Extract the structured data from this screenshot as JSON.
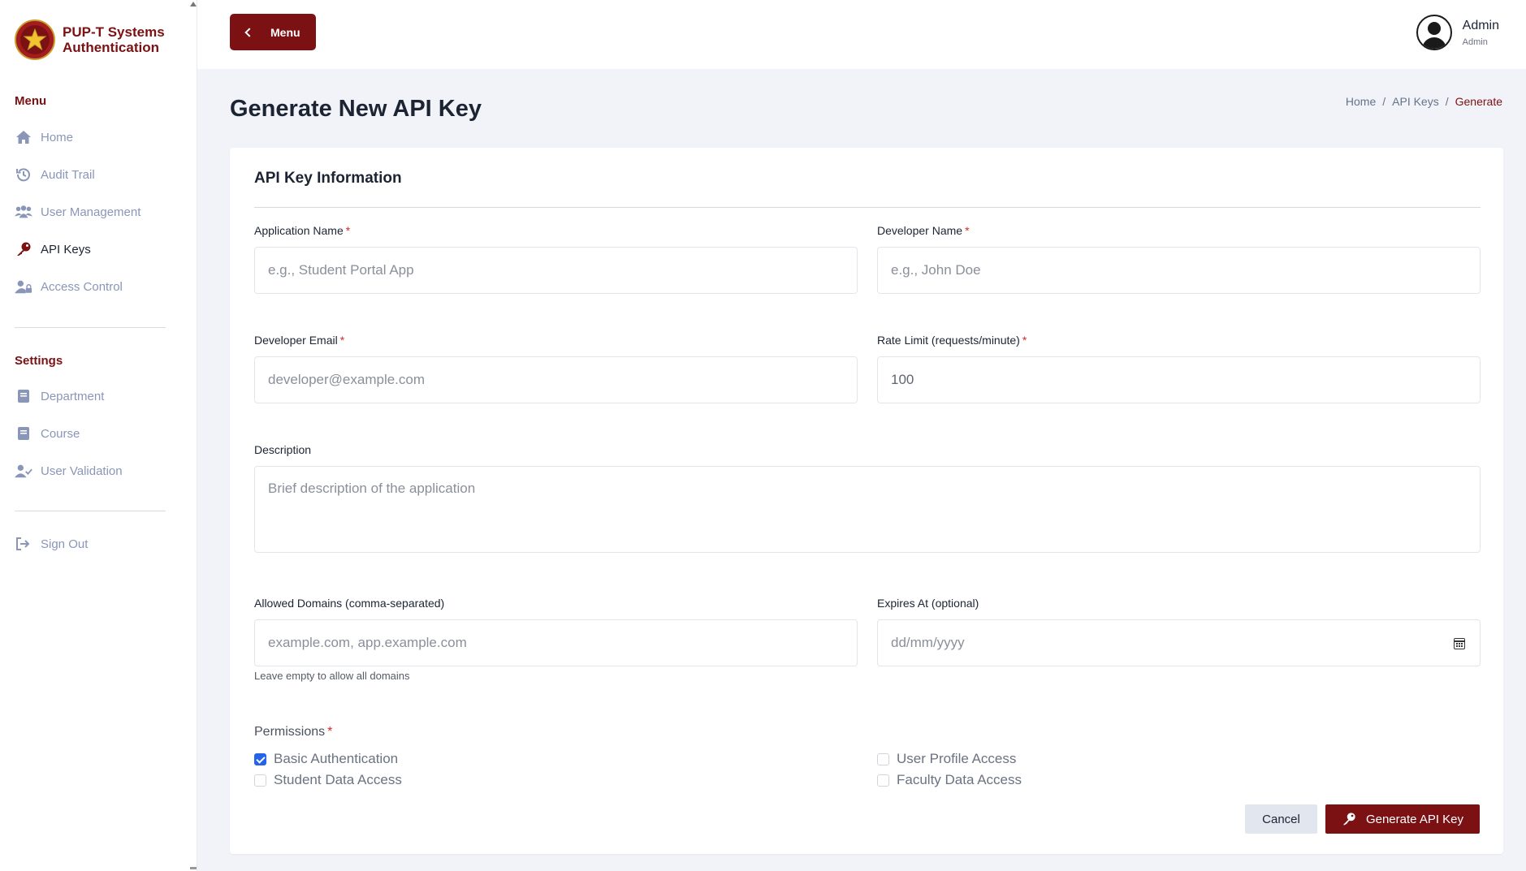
{
  "app": {
    "brand_line1": "PUP-T Systems",
    "brand_line2": "Authentication"
  },
  "sidebar": {
    "menu_title": "Menu",
    "menu_items": [
      {
        "label": "Home",
        "icon": "home-icon"
      },
      {
        "label": "Audit Trail",
        "icon": "history-icon"
      },
      {
        "label": "User Management",
        "icon": "users-icon"
      },
      {
        "label": "API Keys",
        "icon": "key-icon",
        "active": true
      },
      {
        "label": "Access Control",
        "icon": "user-lock-icon"
      }
    ],
    "settings_title": "Settings",
    "settings_items": [
      {
        "label": "Department",
        "icon": "book-icon"
      },
      {
        "label": "Course",
        "icon": "book-icon"
      },
      {
        "label": "User Validation",
        "icon": "user-check-icon"
      }
    ],
    "signout_label": "Sign Out"
  },
  "header": {
    "menu_button": "Menu",
    "user_name": "Admin",
    "user_role": "Admin"
  },
  "page": {
    "title": "Generate New API Key",
    "breadcrumb": [
      "Home",
      "/",
      "API Keys",
      "/",
      "Generate"
    ]
  },
  "form": {
    "section_title": "API Key Information",
    "app_name": {
      "label": "Application Name",
      "placeholder": "e.g., Student Portal App"
    },
    "dev_name": {
      "label": "Developer Name",
      "placeholder": "e.g., John Doe"
    },
    "dev_email": {
      "label": "Developer Email",
      "placeholder": "developer@example.com"
    },
    "rate_limit": {
      "label": "Rate Limit (requests/minute)",
      "value": "100"
    },
    "description": {
      "label": "Description",
      "placeholder": "Brief description of the application"
    },
    "domains": {
      "label": "Allowed Domains (comma-separated)",
      "placeholder": "example.com, app.example.com",
      "hint": "Leave empty to allow all domains"
    },
    "expires": {
      "label": "Expires At (optional)",
      "placeholder": "dd/mm/yyyy"
    },
    "permissions_title": "Permissions",
    "permissions": [
      {
        "label": "Basic Authentication",
        "checked": true
      },
      {
        "label": "User Profile Access",
        "checked": false
      },
      {
        "label": "Student Data Access",
        "checked": false
      },
      {
        "label": "Faculty Data Access",
        "checked": false
      }
    ],
    "required_mark": "*",
    "cancel_label": "Cancel",
    "generate_label": "Generate API Key"
  },
  "colors": {
    "brand": "#7b1113",
    "accent": "#2563eb",
    "required": "#dc2626"
  }
}
